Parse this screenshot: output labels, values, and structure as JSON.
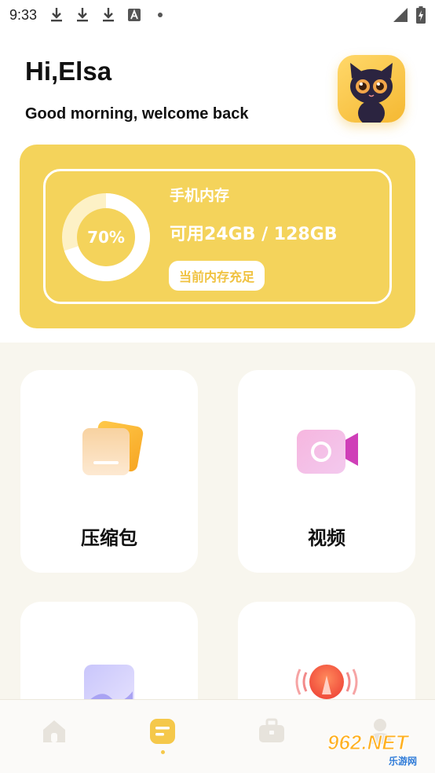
{
  "status_bar": {
    "time": "9:33",
    "left_icons": [
      "download-icon",
      "download-icon",
      "download-icon",
      "font-a-icon",
      "dot-icon"
    ],
    "right_icons": [
      "cell-signal-icon",
      "battery-charging-icon"
    ]
  },
  "header": {
    "greeting": "Hi,Elsa",
    "subtitle": "Good morning, welcome back",
    "avatar_icon": "black-cat-avatar-icon"
  },
  "storage": {
    "percent_text": "70%",
    "percent_value": 0.7,
    "label": "手机内存",
    "value": "可用24GB / 128GB",
    "status_badge": "当前内存充足",
    "card_color": "#f4d35b",
    "badge_text_color": "#f0c240"
  },
  "tiles": [
    {
      "label": "压缩包",
      "icon": "archive-folder-icon"
    },
    {
      "label": "视频",
      "icon": "video-camera-icon"
    },
    {
      "label": "",
      "icon": "image-gallery-icon"
    },
    {
      "label": "",
      "icon": "audio-speaker-icon"
    }
  ],
  "bottom_nav": {
    "items": [
      "home-icon",
      "files-icon",
      "toolbox-icon",
      "profile-icon"
    ],
    "active_index": 1,
    "active_color": "#f5c84a"
  },
  "watermark": {
    "main": "962.NET",
    "sub": "乐游网"
  }
}
